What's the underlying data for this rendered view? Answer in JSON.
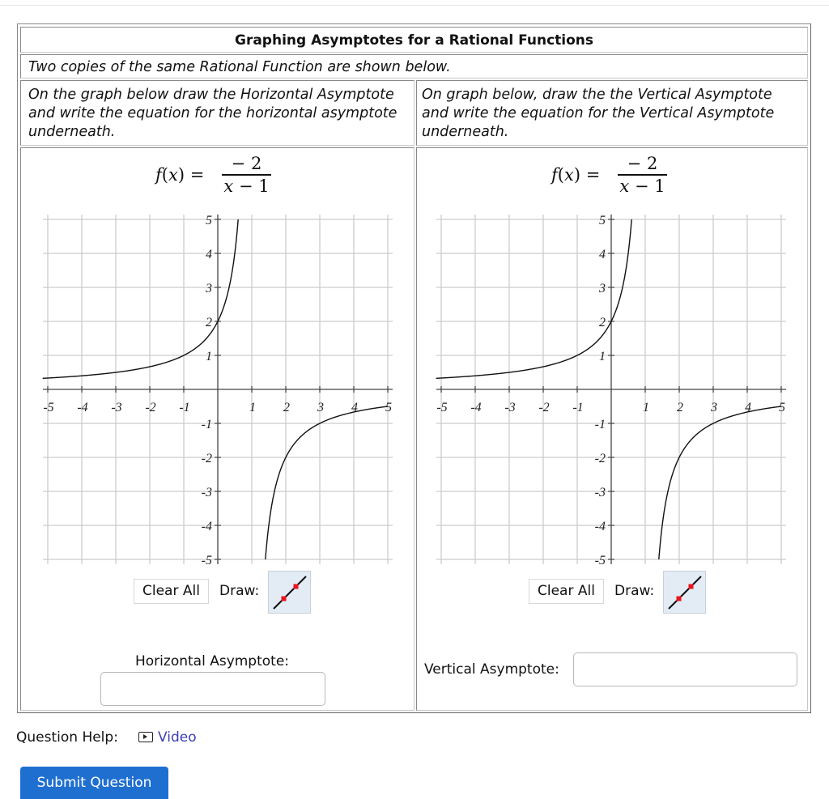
{
  "question": {
    "title": "Graphing Asymptotes for a Rational Functions",
    "intro": "Two copies of the same Rational Function are shown below.",
    "left_instruction": "On the graph below draw the Horizontal Asymptote and write the equation for the horizontal asymptote underneath.",
    "right_instruction": "On graph below, draw the the Vertical Asymptote and write the equation for the Vertical Asymptote underneath."
  },
  "formula": {
    "lhs_func": "f",
    "lhs_var": "x",
    "numerator": "− 2",
    "denominator_var": "x",
    "denominator_rest": " − 1"
  },
  "chart_data": [
    {
      "type": "line",
      "title": "f(x) = -2/(x - 1)",
      "function": "-2/(x-1)",
      "xlim": [
        -5,
        5
      ],
      "ylim": [
        -5,
        5
      ],
      "grid": true,
      "x_ticks": [
        "-5",
        "-4",
        "-3",
        "-2",
        "-1",
        "1",
        "2",
        "3",
        "4",
        "5"
      ],
      "y_ticks": [
        "5",
        "4",
        "3",
        "2",
        "1",
        "-1",
        "-2",
        "-3",
        "-4",
        "-5"
      ],
      "series": [
        {
          "name": "f(x)",
          "points": [
            [
              -5,
              0.33
            ],
            [
              -4,
              0.4
            ],
            [
              -3,
              0.5
            ],
            [
              -2,
              0.67
            ],
            [
              -1,
              1
            ],
            [
              0,
              2
            ],
            [
              0.6,
              5
            ],
            [
              1.4,
              -5
            ],
            [
              2,
              -2
            ],
            [
              3,
              -1
            ],
            [
              4,
              -0.67
            ],
            [
              5,
              -0.5
            ]
          ]
        }
      ]
    },
    {
      "type": "line",
      "title": "f(x) = -2/(x - 1)",
      "function": "-2/(x-1)",
      "xlim": [
        -5,
        5
      ],
      "ylim": [
        -5,
        5
      ],
      "grid": true,
      "x_ticks": [
        "-5",
        "-4",
        "-3",
        "-2",
        "-1",
        "1",
        "2",
        "3",
        "4",
        "5"
      ],
      "y_ticks": [
        "5",
        "4",
        "3",
        "2",
        "1",
        "-1",
        "-2",
        "-3",
        "-4",
        "-5"
      ],
      "series": [
        {
          "name": "f(x)",
          "points": [
            [
              -5,
              0.33
            ],
            [
              -4,
              0.4
            ],
            [
              -3,
              0.5
            ],
            [
              -2,
              0.67
            ],
            [
              -1,
              1
            ],
            [
              0,
              2
            ],
            [
              0.6,
              5
            ],
            [
              1.4,
              -5
            ],
            [
              2,
              -2
            ],
            [
              3,
              -1
            ],
            [
              4,
              -0.67
            ],
            [
              5,
              -0.5
            ]
          ]
        }
      ]
    }
  ],
  "controls": {
    "clear_all": "Clear All",
    "draw_label": "Draw:",
    "draw_tool_icon": "line-tool-icon"
  },
  "answers": {
    "horizontal_label": "Horizontal Asymptote:",
    "horizontal_value": "",
    "vertical_label": "Vertical Asymptote:",
    "vertical_value": ""
  },
  "help": {
    "label": "Question Help:",
    "video_label": "Video",
    "video_icon": "video-play-icon"
  },
  "submit_label": "Submit Question",
  "colors": {
    "curve": "#111111",
    "grid": "#cccccc",
    "axis": "#444444",
    "draw_tool_bg": "#e3ebf5",
    "draw_tool_point": "#e8141c",
    "link": "#3b3fb3",
    "submit_bg": "#1f6fd1"
  }
}
